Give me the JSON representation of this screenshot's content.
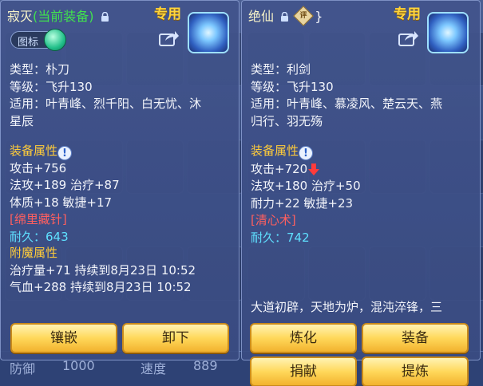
{
  "background": {
    "footer_left": "防御",
    "footer_mid": "1000",
    "footer_right_label": "速度",
    "footer_right_value": "889"
  },
  "left_item": {
    "name": "寂灭",
    "status": "(当前装备)",
    "tag": "专用",
    "toggle_label": "图标",
    "type": "类型：朴刀",
    "level": "等级：飞升130",
    "suitable_1": "适用：叶青峰、烈千阳、白无忧、沐",
    "suitable_2": "星辰",
    "attr_title": "装备属性",
    "attack": "攻击+756",
    "magic_heal": "法攻+189 治疗+87",
    "body_agility": "体质+18 敏捷+17",
    "skill": "[绵里藏针]",
    "durability": "耐久：643",
    "enchant_title": "附魔属性",
    "enchant_1": "治疗量+71 持续到8月23日 10:52",
    "enchant_2": "气血+288 持续到8月23日 10:52",
    "buttons": {
      "inlay": "镶嵌",
      "unequip": "卸下"
    }
  },
  "right_item": {
    "name": "绝仙",
    "seal": "评",
    "tag": "专用",
    "type": "类型：利剑",
    "level": "等级：飞升130",
    "suitable_1": "适用：叶青峰、慕凌风、楚云天、燕",
    "suitable_2": "归行、羽无殇",
    "attr_title": "装备属性",
    "attack": "攻击+720",
    "magic_heal": "法攻+180 治疗+50",
    "stamina_agility": "耐力+22 敏捷+23",
    "skill": "[清心术]",
    "durability": "耐久：742",
    "description": "大道初辟，天地为炉，混沌淬锋，三",
    "buttons": {
      "refine": "炼化",
      "equip": "装备",
      "donate": "捐献",
      "extract": "提炼"
    }
  },
  "colors": {
    "gold_title": "#ffcc3a",
    "green_status": "#41e24e",
    "skill_red": "#ff5f5f",
    "durability_cyan": "#5fe0ff"
  }
}
